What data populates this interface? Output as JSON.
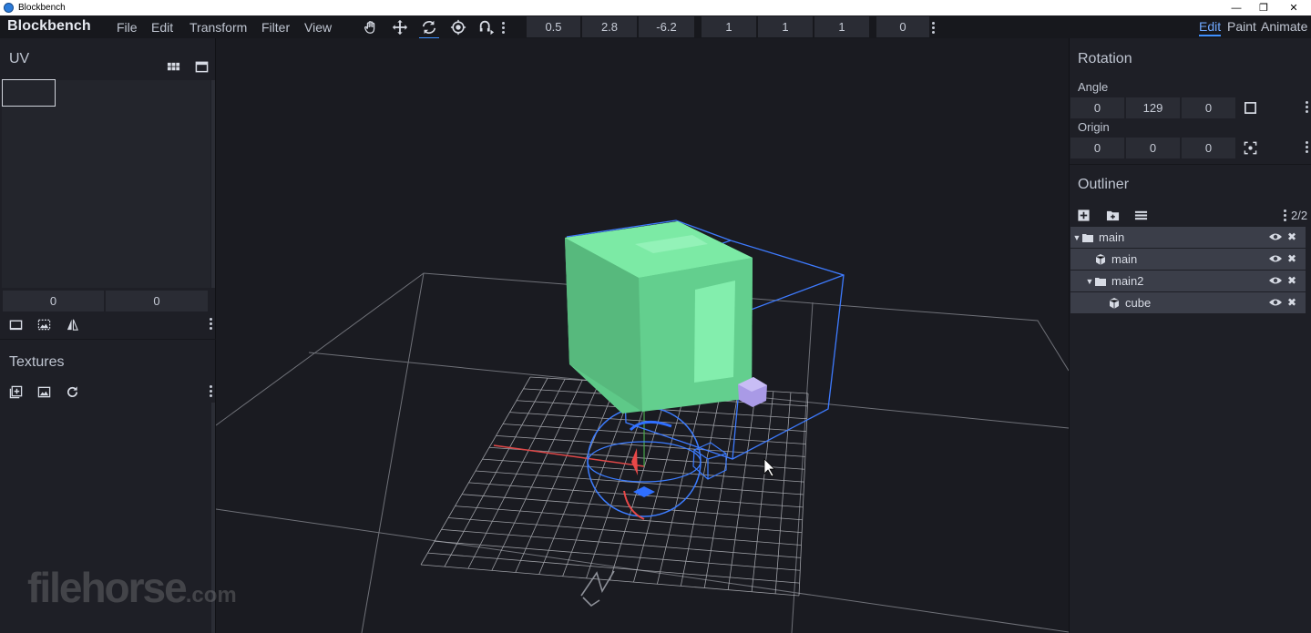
{
  "window": {
    "title": "Blockbench",
    "controls": [
      "—",
      "❐",
      "✕"
    ]
  },
  "menubar": {
    "brand": "Blockbench",
    "menus": [
      "File",
      "Edit",
      "Transform",
      "Filter",
      "View"
    ],
    "tools": [
      {
        "icon": "hand-icon",
        "active": false
      },
      {
        "icon": "move-icon",
        "active": false
      },
      {
        "icon": "rotate-icon",
        "active": true
      },
      {
        "icon": "pivot-icon",
        "active": false
      },
      {
        "icon": "vertex-snap-icon",
        "active": false
      }
    ],
    "position": [
      "0.5",
      "2.8",
      "-6.2"
    ],
    "scale": [
      "1",
      "1",
      "1"
    ],
    "inflate": "0",
    "modes": [
      "Edit",
      "Paint",
      "Animate"
    ],
    "active_mode": "Edit"
  },
  "left": {
    "uv_title": "UV",
    "uv_values": [
      "0",
      "0"
    ],
    "textures_title": "Textures"
  },
  "right": {
    "rotation_title": "Rotation",
    "angle_label": "Angle",
    "angle": [
      "0",
      "129",
      "0"
    ],
    "origin_label": "Origin",
    "origin": [
      "0",
      "0",
      "0"
    ],
    "outliner_title": "Outliner",
    "outliner_count": "2/2",
    "outliner": [
      {
        "name": "main",
        "type": "group",
        "level": 0
      },
      {
        "name": "main",
        "type": "cube",
        "level": 1
      },
      {
        "name": "main2",
        "type": "group",
        "level": 1
      },
      {
        "name": "cube",
        "type": "cube",
        "level": 2
      }
    ]
  },
  "viewport": {
    "cube_color": "#6fe39a",
    "selection_color": "#3e7bff"
  },
  "watermark": {
    "text": "filehorse",
    "suffix": ".com"
  }
}
